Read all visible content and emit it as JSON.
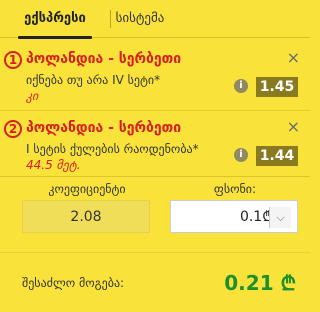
{
  "tabs": {
    "express_label": "ექსპრესი",
    "system_label": "სისტემა"
  },
  "bets": [
    {
      "index": "1",
      "match": "პოლანდია - სერბეთი",
      "market": "იქნება თუ არა IV სეტი*",
      "selection": "კი",
      "odds": "1.45",
      "info_symbol": "i",
      "close_symbol": "×"
    },
    {
      "index": "2",
      "match": "პოლანდია - სერბეთი",
      "market": "I სეტის ქულების რაოდენობა*",
      "selection": "44.5 მეტ.",
      "odds": "1.44",
      "info_symbol": "i",
      "close_symbol": "×"
    }
  ],
  "coefficient": {
    "label": "კოეფიციენტი",
    "value": "2.08"
  },
  "stake": {
    "label": "ფსონი:",
    "value": "0.1₾",
    "toggle_symbol": "⌵"
  },
  "possible_win": {
    "label": "შესაძლო მოგება:",
    "value": "0.21 ₾"
  },
  "colors": {
    "background": "#f9e33a",
    "match_red": "#d8201f",
    "odds_box": "#8a7a1f",
    "win_green": "#1f8f2c"
  }
}
